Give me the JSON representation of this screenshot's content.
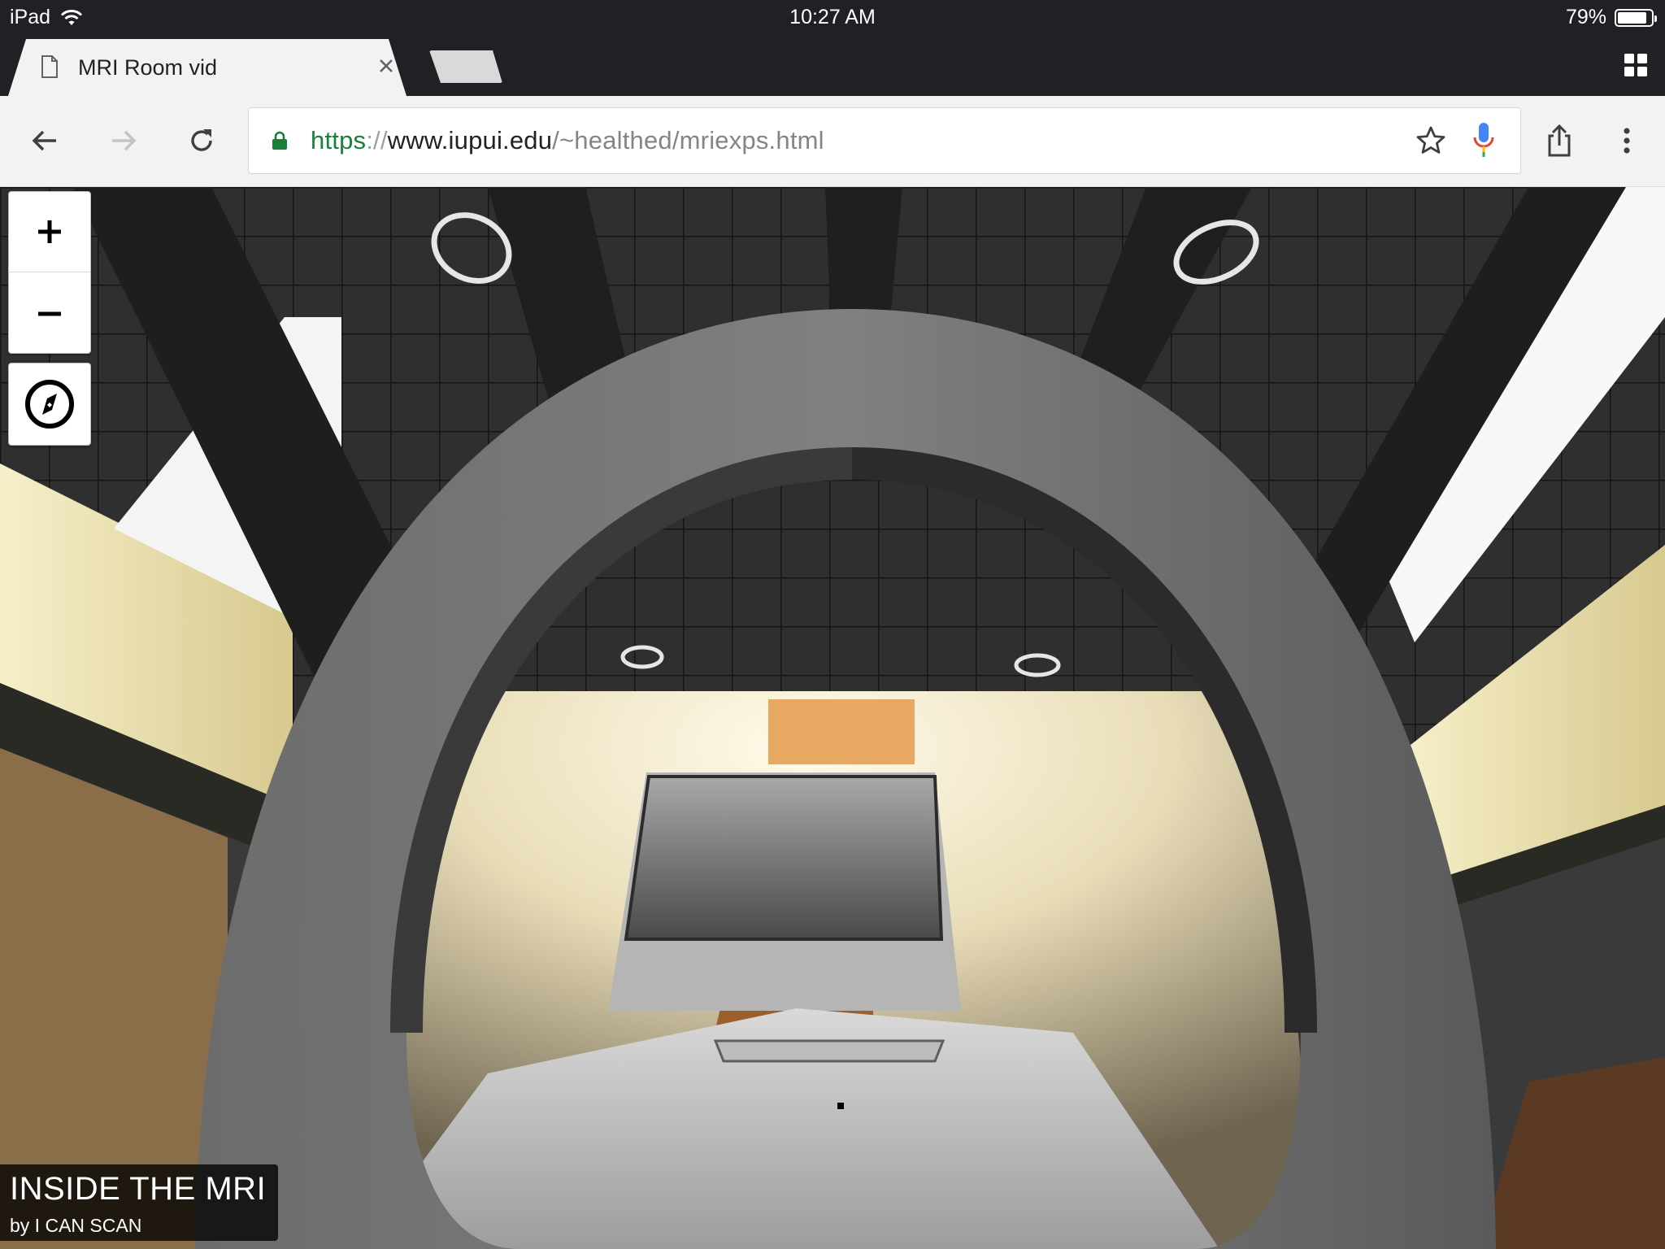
{
  "status_bar": {
    "device": "iPad",
    "time": "10:27 AM",
    "battery": "79%",
    "battery_level": 0.79
  },
  "tabs": [
    {
      "title": "MRI Room vid",
      "active": true
    }
  ],
  "toolbar": {
    "url_scheme": "https",
    "url_separator": "://",
    "url_host": "www.iupui.edu",
    "url_path": "/~healthed/mriexps.html"
  },
  "viewer": {
    "zoom_in_label": "+",
    "zoom_out_label": "−"
  },
  "caption": {
    "title": "INSIDE THE MRI",
    "author": "by I CAN SCAN"
  },
  "icons": {
    "wifi": "wifi-icon",
    "battery": "battery-icon",
    "tab_document": "document-icon",
    "tab_close": "close-icon",
    "tab_switcher": "tab-switcher-icon",
    "back": "back-arrow-icon",
    "forward": "forward-arrow-icon",
    "reload": "reload-icon",
    "lock": "lock-icon",
    "bookmark": "star-icon",
    "voice": "microphone-icon",
    "share": "share-icon",
    "menu": "more-vert-icon",
    "compass": "compass-icon"
  },
  "colors": {
    "chrome_dark": "#202124",
    "toolbar_bg": "#f2f2f2",
    "url_secure_green": "#188038",
    "ceiling": "#2e2e2e",
    "wall_warm": "#d8c9a3"
  }
}
